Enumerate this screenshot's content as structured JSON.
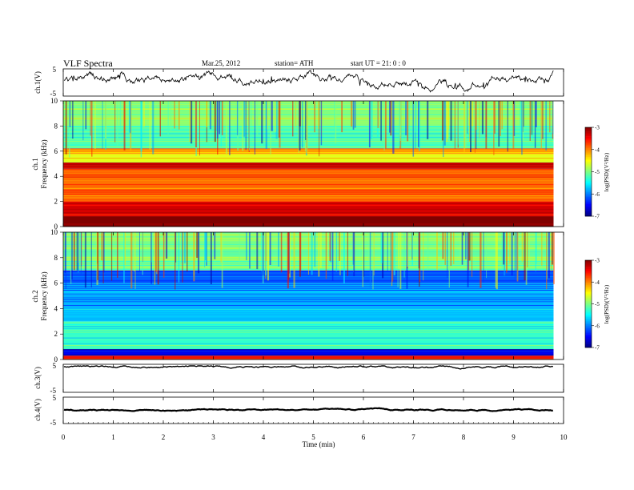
{
  "header": {
    "title": "VLF  Spectra",
    "date": "Mar.25, 2012",
    "station": "station= ATH",
    "start": "start  UT  =    21: 0   : 0"
  },
  "chart_data": [
    {
      "type": "line",
      "panel": "ch1-waveform",
      "ylabel": "ch.1(V)",
      "yticks": [
        "5",
        "-5"
      ],
      "ylim": [
        -5,
        5
      ],
      "trace_color": "#000000",
      "trace_level": "noisy signal, roughly 0 to +5 V"
    },
    {
      "type": "heatmap",
      "panel": "ch1-spectrogram",
      "ylabel_channel": "ch.1",
      "ylabel": "Frequency  (kHz)",
      "yticks": [
        "10",
        "8",
        "6",
        "4",
        "2",
        "0"
      ],
      "ylim": [
        0,
        10
      ],
      "colorbar_label": "log(PSD)(V²/Hz)",
      "colorbar_ticks": [
        "-3",
        "-4",
        "-5",
        "-6",
        "-7"
      ],
      "clim": [
        -7,
        -3
      ],
      "dominant_bands_khz": [
        {
          "from": 0.0,
          "to": 0.8,
          "level": -3.0
        },
        {
          "from": 0.8,
          "to": 2.0,
          "level": -3.4
        },
        {
          "from": 2.0,
          "to": 4.6,
          "level": -3.9
        },
        {
          "from": 4.6,
          "to": 5.1,
          "level": -3.2
        },
        {
          "from": 5.1,
          "to": 5.8,
          "level": -4.6
        },
        {
          "from": 5.8,
          "to": 6.2,
          "level": -4.1
        },
        {
          "from": 6.2,
          "to": 8.0,
          "level": -5.2
        },
        {
          "from": 8.0,
          "to": 10.0,
          "level": -4.9
        }
      ]
    },
    {
      "type": "heatmap",
      "panel": "ch2-spectrogram",
      "ylabel_channel": "ch.2",
      "ylabel": "Frequency  (kHz)",
      "yticks": [
        "10",
        "8",
        "6",
        "4",
        "2",
        "0"
      ],
      "ylim": [
        0,
        10
      ],
      "colorbar_label": "log(PSD)(V²/Hz)",
      "colorbar_ticks": [
        "-3",
        "-4",
        "-5",
        "-6",
        "-7"
      ],
      "clim": [
        -7,
        -3
      ],
      "dominant_bands_khz": [
        {
          "from": 0.0,
          "to": 0.3,
          "level": -3.6
        },
        {
          "from": 0.3,
          "to": 0.8,
          "level": -6.6
        },
        {
          "from": 0.8,
          "to": 3.0,
          "level": -5.3
        },
        {
          "from": 3.0,
          "to": 6.0,
          "level": -5.8
        },
        {
          "from": 6.0,
          "to": 7.0,
          "level": -6.2
        },
        {
          "from": 7.0,
          "to": 10.0,
          "level": -5.0
        }
      ]
    },
    {
      "type": "line",
      "panel": "ch3-waveform",
      "ylabel": "ch.3(V)",
      "yticks": [
        "5",
        "-5"
      ],
      "ylim": [
        -5,
        5
      ],
      "trace_color": "#000000",
      "trace_level": "flat near 5 V"
    },
    {
      "type": "line",
      "panel": "ch4-waveform",
      "ylabel": "ch.4(V)",
      "yticks": [
        "5",
        "-5"
      ],
      "ylim": [
        -5,
        5
      ],
      "trace_color": "#000000",
      "trace_level": "flat near 0 V"
    }
  ],
  "xaxis": {
    "label": "Time  (min)",
    "ticks": [
      "0",
      "1",
      "2",
      "3",
      "4",
      "5",
      "6",
      "7",
      "8",
      "9",
      "10"
    ],
    "xlim": [
      0,
      10
    ],
    "data_end_min": 9.8
  }
}
